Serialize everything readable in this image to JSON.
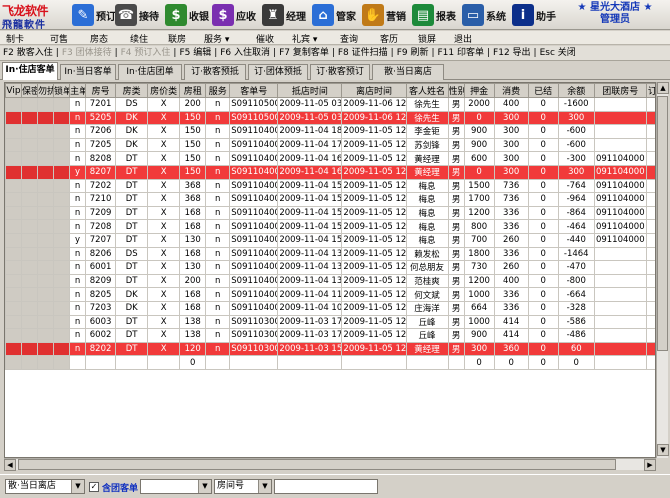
{
  "app": {
    "logo_line1": "飞龙软件",
    "logo_line2": "飛龍軟件",
    "brand_line1": "★ 星光大酒店 ★",
    "brand_line2": "管理员"
  },
  "toolbar": [
    {
      "label": "预订",
      "icon": "book-icon",
      "color": "#2b6ed6"
    },
    {
      "label": "接待",
      "icon": "reception-icon",
      "color": "#4a4a4a"
    },
    {
      "label": "收银",
      "icon": "money-bag-icon",
      "color": "#2f8a2f"
    },
    {
      "label": "应收",
      "icon": "dollar-icon",
      "color": "#7a2fb0"
    },
    {
      "label": "经理",
      "icon": "manager-icon",
      "color": "#3a3a3a"
    },
    {
      "label": "管家",
      "icon": "housekeeper-icon",
      "color": "#2b6ed6"
    },
    {
      "label": "营销",
      "icon": "handshake-icon",
      "color": "#c07a18"
    },
    {
      "label": "报表",
      "icon": "report-icon",
      "color": "#1d8a3a"
    },
    {
      "label": "系统",
      "icon": "computer-icon",
      "color": "#2a5ea8"
    },
    {
      "label": "助手",
      "icon": "info-icon",
      "color": "#0c2f8a"
    }
  ],
  "menu": [
    "制卡",
    "可售",
    "房态",
    "续住",
    "联房",
    "服务 ▾",
    "催收",
    "礼宾 ▾",
    "查询",
    "客历",
    "锁屏",
    "退出"
  ],
  "shortcuts": [
    {
      "label": "F2 散客入住",
      "disabled": false
    },
    {
      "label": "F3 团体接待",
      "disabled": true
    },
    {
      "label": "F4 预订入住",
      "disabled": true
    },
    {
      "label": "F5 编辑",
      "disabled": false
    },
    {
      "label": "F6 入住取消",
      "disabled": false
    },
    {
      "label": "F7 复制客单",
      "disabled": false
    },
    {
      "label": "F8 证件扫描",
      "disabled": false
    },
    {
      "label": "F9 刷新",
      "disabled": false
    },
    {
      "label": "F11 印客单",
      "disabled": false
    },
    {
      "label": "F12 导出",
      "disabled": false
    },
    {
      "label": "Esc 关闭",
      "disabled": false
    }
  ],
  "tabs": [
    {
      "label": "In·住店客单",
      "active": true
    },
    {
      "label": "In·当日客单",
      "active": false
    },
    {
      "label": "In·住店团单",
      "active": false
    },
    {
      "label": "订·散客预抵",
      "active": false
    },
    {
      "label": "订·团体预抵",
      "active": false
    },
    {
      "label": "订·散客预订",
      "active": false
    },
    {
      "label": "散·当日离店",
      "active": false
    }
  ],
  "columns": [
    "Vip",
    "保密",
    "勿扰",
    "锁单",
    "主单",
    "房号",
    "房类",
    "房价类",
    "房租",
    "服务",
    "客单号",
    "抵店时间",
    "离店时间",
    "客人姓名",
    "性别",
    "押金",
    "消费",
    "已结",
    "余额",
    "团联房号",
    "订房人"
  ],
  "rows": [
    {
      "style": "normal",
      "cells": [
        "",
        "",
        "",
        "",
        "n",
        "7201",
        "DS",
        "X",
        "200",
        "n",
        "S0911050004",
        "2009-11-05 03:16",
        "2009-11-06 12:00",
        "徐先生",
        "男",
        "2000",
        "400",
        "0",
        "-1600",
        "",
        ""
      ]
    },
    {
      "style": "red",
      "cells": [
        "",
        "",
        "",
        "",
        "n",
        "5205",
        "DK",
        "X",
        "150",
        "n",
        "S0911050002",
        "2009-11-05 03:15",
        "2009-11-06 12:00",
        "徐先生",
        "男",
        "0",
        "300",
        "0",
        "300",
        "",
        ""
      ]
    },
    {
      "style": "normal",
      "cells": [
        "",
        "",
        "",
        "",
        "n",
        "7206",
        "DK",
        "X",
        "150",
        "n",
        "S0911040029",
        "2009-11-04 18:50",
        "2009-11-05 12:00",
        "李金钜",
        "男",
        "900",
        "300",
        "0",
        "-600",
        "",
        ""
      ]
    },
    {
      "style": "normal",
      "cells": [
        "",
        "",
        "",
        "",
        "n",
        "7205",
        "DK",
        "X",
        "150",
        "n",
        "S0911040026",
        "2009-11-04 17:35",
        "2009-11-05 12:00",
        "苏剑锋",
        "男",
        "900",
        "300",
        "0",
        "-600",
        "",
        ""
      ]
    },
    {
      "style": "normal",
      "cells": [
        "",
        "",
        "",
        "",
        "n",
        "8208",
        "DT",
        "X",
        "150",
        "n",
        "S0911040025",
        "2009-11-04 16:09",
        "2009-11-05 12:00",
        "黄经理",
        "男",
        "600",
        "300",
        "0",
        "-300",
        "091104000",
        ""
      ]
    },
    {
      "style": "red",
      "cells": [
        "",
        "",
        "",
        "",
        "y",
        "8207",
        "DT",
        "X",
        "150",
        "n",
        "S0911040024",
        "2009-11-04 16:09",
        "2009-11-05 12:00",
        "黄经理",
        "男",
        "0",
        "300",
        "0",
        "300",
        "091104000",
        ""
      ]
    },
    {
      "style": "normal",
      "cells": [
        "",
        "",
        "",
        "",
        "n",
        "7202",
        "DT",
        "X",
        "368",
        "n",
        "S0911040021",
        "2009-11-04 15:39",
        "2009-11-05 12:00",
        "梅息",
        "男",
        "1500",
        "736",
        "0",
        "-764",
        "091104000",
        ""
      ]
    },
    {
      "style": "normal",
      "cells": [
        "",
        "",
        "",
        "",
        "n",
        "7210",
        "DT",
        "X",
        "368",
        "n",
        "S0911040020",
        "2009-11-04 15:39",
        "2009-11-05 12:00",
        "梅息",
        "男",
        "1700",
        "736",
        "0",
        "-964",
        "091104000",
        ""
      ]
    },
    {
      "style": "normal",
      "cells": [
        "",
        "",
        "",
        "",
        "n",
        "7209",
        "DT",
        "X",
        "168",
        "n",
        "S0911040019",
        "2009-11-04 15:39",
        "2009-11-05 12:00",
        "梅息",
        "男",
        "1200",
        "336",
        "0",
        "-864",
        "091104000",
        ""
      ]
    },
    {
      "style": "normal",
      "cells": [
        "",
        "",
        "",
        "",
        "n",
        "7208",
        "DT",
        "X",
        "168",
        "n",
        "S0911040018",
        "2009-11-04 15:39",
        "2009-11-05 12:00",
        "梅息",
        "男",
        "800",
        "336",
        "0",
        "-464",
        "091104000",
        ""
      ]
    },
    {
      "style": "normal",
      "cells": [
        "",
        "",
        "",
        "",
        "y",
        "7207",
        "DT",
        "X",
        "130",
        "n",
        "S0911040017",
        "2009-11-04 15:39",
        "2009-11-05 12:00",
        "梅息",
        "男",
        "700",
        "260",
        "0",
        "-440",
        "091104000",
        ""
      ]
    },
    {
      "style": "normal",
      "cells": [
        "",
        "",
        "",
        "",
        "n",
        "8206",
        "DS",
        "X",
        "168",
        "n",
        "S0911040015",
        "2009-11-04 13:51",
        "2009-11-05 12:00",
        "赖发松",
        "男",
        "1800",
        "336",
        "0",
        "-1464",
        "",
        ""
      ]
    },
    {
      "style": "normal",
      "cells": [
        "",
        "",
        "",
        "",
        "n",
        "6001",
        "DT",
        "X",
        "130",
        "n",
        "S0911040014",
        "2009-11-04 13:43",
        "2009-11-05 12:00",
        "何总朋友",
        "男",
        "730",
        "260",
        "0",
        "-470",
        "",
        ""
      ]
    },
    {
      "style": "normal",
      "cells": [
        "",
        "",
        "",
        "",
        "n",
        "8209",
        "DT",
        "X",
        "200",
        "n",
        "S0911040011",
        "2009-11-04 13:32",
        "2009-11-05 12:00",
        "范桂爽",
        "男",
        "1200",
        "400",
        "0",
        "-800",
        "",
        ""
      ]
    },
    {
      "style": "normal",
      "cells": [
        "",
        "",
        "",
        "",
        "n",
        "8205",
        "DK",
        "X",
        "168",
        "n",
        "S0911040003",
        "2009-11-04 11:45",
        "2009-11-05 12:00",
        "何文斌",
        "男",
        "1000",
        "336",
        "0",
        "-664",
        "",
        ""
      ]
    },
    {
      "style": "normal",
      "cells": [
        "",
        "",
        "",
        "",
        "n",
        "7203",
        "DK",
        "X",
        "168",
        "n",
        "S0911040002",
        "2009-11-04 10:01",
        "2009-11-05 12:00",
        "庄海洋",
        "男",
        "664",
        "336",
        "0",
        "-328",
        "",
        ""
      ]
    },
    {
      "style": "normal",
      "cells": [
        "",
        "",
        "",
        "",
        "n",
        "6003",
        "DT",
        "X",
        "138",
        "n",
        "S0911030030",
        "2009-11-03 17:55",
        "2009-11-05 12:00",
        "丘峰",
        "男",
        "1000",
        "414",
        "0",
        "-586",
        "",
        ""
      ]
    },
    {
      "style": "normal",
      "cells": [
        "",
        "",
        "",
        "",
        "n",
        "6002",
        "DT",
        "X",
        "138",
        "n",
        "S0911030029",
        "2009-11-03 17:53",
        "2009-11-05 12:00",
        "丘峰",
        "男",
        "900",
        "414",
        "0",
        "-486",
        "",
        ""
      ]
    },
    {
      "style": "red",
      "cells": [
        "",
        "",
        "",
        "",
        "n",
        "8202",
        "DT",
        "X",
        "120",
        "n",
        "S0911030024",
        "2009-11-03 15:14",
        "2009-11-05 12:00",
        "黄经理",
        "男",
        "300",
        "360",
        "0",
        "60",
        "",
        ""
      ]
    },
    {
      "style": "total",
      "cells": [
        "",
        "",
        "",
        "",
        "",
        "",
        "",
        "",
        "0",
        "",
        "",
        "",
        "",
        "",
        "",
        "0",
        "0",
        "0",
        "0",
        "",
        ""
      ]
    }
  ],
  "filter": {
    "view_select": "散·当日离店",
    "include_group_label": "含团客单",
    "include_group_checked": "✓",
    "field_select": "房间号",
    "search_value": ""
  }
}
